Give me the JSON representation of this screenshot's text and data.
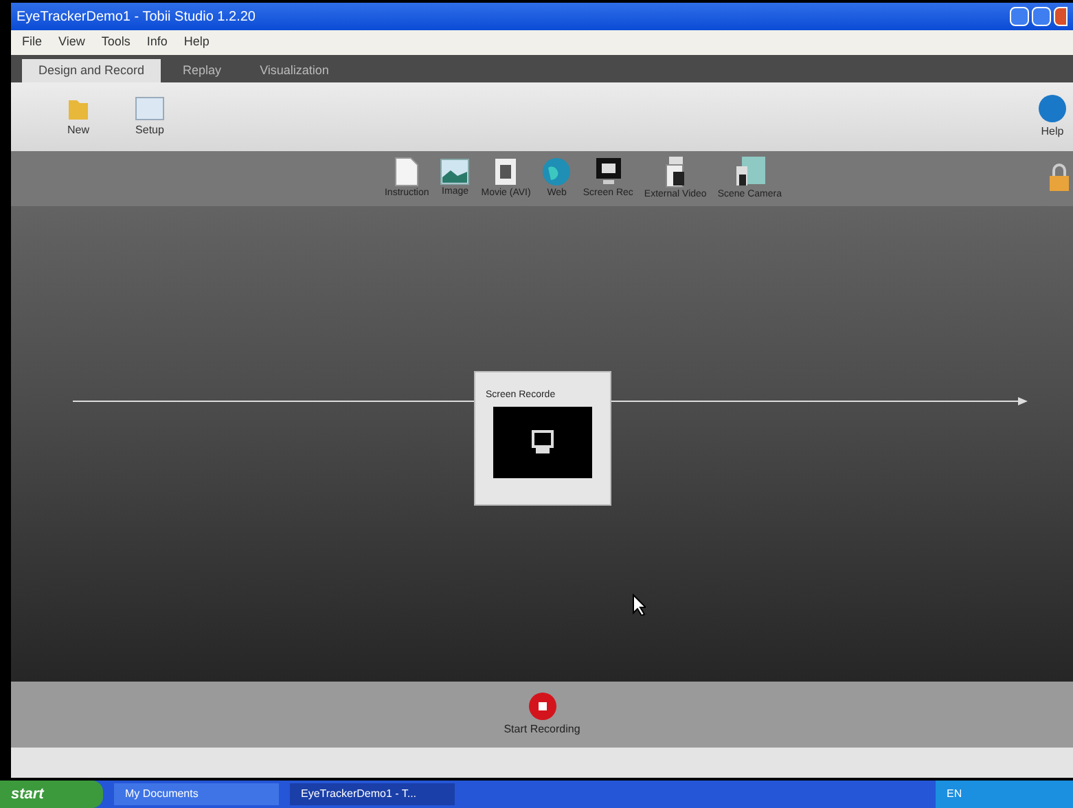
{
  "window": {
    "title": "EyeTrackerDemo1 - Tobii Studio 1.2.20"
  },
  "menu": [
    "File",
    "View",
    "Tools",
    "Info",
    "Help"
  ],
  "tabs": [
    {
      "label": "Design and Record",
      "selected": true
    },
    {
      "label": "Replay",
      "selected": false
    },
    {
      "label": "Visualization",
      "selected": false
    }
  ],
  "toolbar": {
    "new": "New",
    "setup": "Setup",
    "help": "Help"
  },
  "elements": [
    {
      "label": "Instruction",
      "kind": "doc"
    },
    {
      "label": "Image",
      "kind": "image"
    },
    {
      "label": "Movie (AVI)",
      "kind": "movie"
    },
    {
      "label": "Web",
      "kind": "web"
    },
    {
      "label": "Screen Rec",
      "kind": "screen"
    },
    {
      "label": "External Video",
      "kind": "video"
    },
    {
      "label": "Scene Camera",
      "kind": "camera"
    }
  ],
  "timeline": {
    "node": "Screen Recorde"
  },
  "record_button": "Start Recording",
  "taskbar": {
    "start": "start",
    "items": [
      {
        "label": "My Documents",
        "selected": false
      },
      {
        "label": "EyeTrackerDemo1 - T...",
        "selected": true
      }
    ],
    "lang": "EN"
  }
}
